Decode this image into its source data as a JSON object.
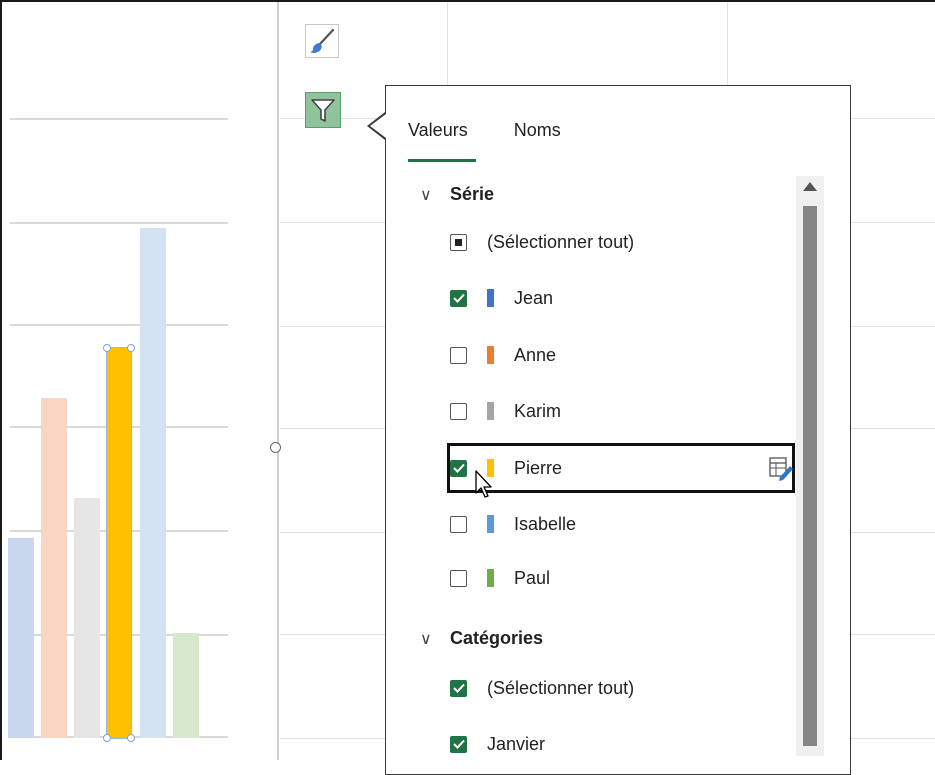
{
  "popup": {
    "tabs": [
      {
        "label": "Valeurs",
        "active": true
      },
      {
        "label": "Noms",
        "active": false
      }
    ],
    "series_section": {
      "title": "Série",
      "items": [
        {
          "label": "(Sélectionner tout)",
          "state": "partial",
          "color": null
        },
        {
          "label": "Jean",
          "state": "checked",
          "color": "#4472c4"
        },
        {
          "label": "Anne",
          "state": "unchecked",
          "color": "#ed7d31"
        },
        {
          "label": "Karim",
          "state": "unchecked",
          "color": "#a5a5a5"
        },
        {
          "label": "Pierre",
          "state": "checked",
          "color": "#ffc000"
        },
        {
          "label": "Isabelle",
          "state": "unchecked",
          "color": "#5b9bd5"
        },
        {
          "label": "Paul",
          "state": "unchecked",
          "color": "#70ad47"
        }
      ]
    },
    "categories_section": {
      "title": "Catégories",
      "items": [
        {
          "label": "(Sélectionner tout)",
          "state": "checked"
        },
        {
          "label": "Janvier",
          "state": "checked"
        }
      ]
    }
  },
  "side_buttons": [
    {
      "icon": "brush-icon"
    },
    {
      "icon": "filter-icon",
      "active": true
    }
  ],
  "chart_data": {
    "type": "bar",
    "categories": [
      "Janvier"
    ],
    "series": [
      {
        "name": "Jean",
        "values": [
          200
        ],
        "color": "#4472c4",
        "faded": true
      },
      {
        "name": "Anne",
        "values": [
          340
        ],
        "color": "#ed7d31",
        "faded": true
      },
      {
        "name": "Karim",
        "values": [
          240
        ],
        "color": "#a5a5a5",
        "faded": true
      },
      {
        "name": "Pierre",
        "values": [
          390
        ],
        "color": "#ffc000",
        "faded": false,
        "selected": true
      },
      {
        "name": "Isabelle",
        "values": [
          510
        ],
        "color": "#5b9bd5",
        "faded": true
      },
      {
        "name": "Paul",
        "values": [
          105
        ],
        "color": "#70ad47",
        "faded": true
      }
    ],
    "grid": true
  }
}
